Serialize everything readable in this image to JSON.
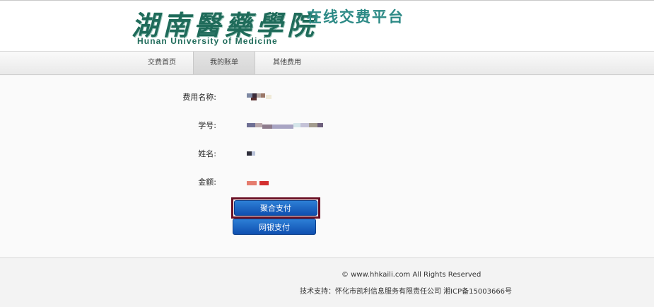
{
  "header": {
    "logo_cn": "湖南醫藥學院",
    "logo_en": "Hunan University of Medicine",
    "platform_title": "在线交费平台"
  },
  "nav": {
    "items": [
      {
        "label": "交费首页",
        "active": false
      },
      {
        "label": "我的账单",
        "active": true
      },
      {
        "label": "其他费用",
        "active": false
      }
    ]
  },
  "form": {
    "fee_name_label": "费用名称:",
    "student_id_label": "学号:",
    "name_label": "姓名:",
    "amount_label": "金额:"
  },
  "buttons": {
    "aggregate_pay": "聚合支付",
    "online_bank_pay": "网银支付"
  },
  "footer": {
    "copyright": "© www.hhkaili.com All Rights Reserved",
    "support": "技术支持：怀化市凯利信息服务有限责任公司  湘ICP备15003666号"
  },
  "colors": {
    "accent_button": "#1a5fc0",
    "focus_border": "#6a1024",
    "logo_green": "#1f6b5a"
  }
}
